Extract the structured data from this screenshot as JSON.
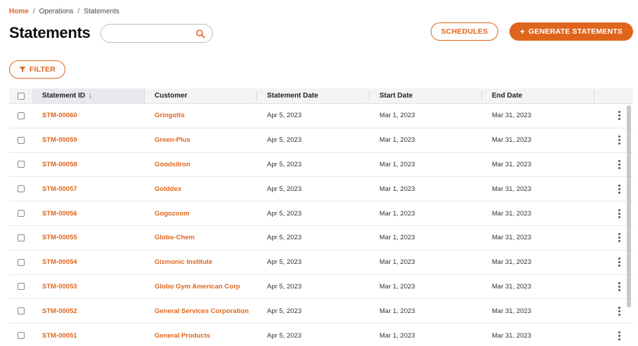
{
  "breadcrumb": {
    "home": "Home",
    "sep1": "/",
    "section": "Operations",
    "sep2": "/",
    "current": "Statements"
  },
  "page_title": "Statements",
  "search": {
    "value": "",
    "placeholder": ""
  },
  "buttons": {
    "schedules": "SCHEDULES",
    "generate_icon": "+",
    "generate": "GENERATE STATEMENTS",
    "filter": "FILTER"
  },
  "columns": {
    "statement_id": "Statement ID",
    "sort_indicator": "↓",
    "customer": "Customer",
    "statement_date": "Statement Date",
    "start_date": "Start Date",
    "end_date": "End Date"
  },
  "rows": [
    {
      "id": "STM-00060",
      "customer": "Gringotts",
      "statement_date": "Apr 5, 2023",
      "start_date": "Mar 1, 2023",
      "end_date": "Mar 31, 2023"
    },
    {
      "id": "STM-00059",
      "customer": "Green-Plus",
      "statement_date": "Apr 5, 2023",
      "start_date": "Mar 1, 2023",
      "end_date": "Mar 31, 2023"
    },
    {
      "id": "STM-00058",
      "customer": "Goodsilron",
      "statement_date": "Apr 5, 2023",
      "start_date": "Mar 1, 2023",
      "end_date": "Mar 31, 2023"
    },
    {
      "id": "STM-00057",
      "customer": "Golddex",
      "statement_date": "Apr 5, 2023",
      "start_date": "Mar 1, 2023",
      "end_date": "Mar 31, 2023"
    },
    {
      "id": "STM-00056",
      "customer": "Gogozoom",
      "statement_date": "Apr 5, 2023",
      "start_date": "Mar 1, 2023",
      "end_date": "Mar 31, 2023"
    },
    {
      "id": "STM-00055",
      "customer": "Globo-Chem",
      "statement_date": "Apr 5, 2023",
      "start_date": "Mar 1, 2023",
      "end_date": "Mar 31, 2023"
    },
    {
      "id": "STM-00054",
      "customer": "Gizmonic Institute",
      "statement_date": "Apr 5, 2023",
      "start_date": "Mar 1, 2023",
      "end_date": "Mar 31, 2023"
    },
    {
      "id": "STM-00053",
      "customer": "Globo Gym American Corp",
      "statement_date": "Apr 5, 2023",
      "start_date": "Mar 1, 2023",
      "end_date": "Mar 31, 2023"
    },
    {
      "id": "STM-00052",
      "customer": "General Services Corporation",
      "statement_date": "Apr 5, 2023",
      "start_date": "Mar 1, 2023",
      "end_date": "Mar 31, 2023"
    },
    {
      "id": "STM-00051",
      "customer": "General Products",
      "statement_date": "Apr 5, 2023",
      "start_date": "Mar 1, 2023",
      "end_date": "Mar 31, 2023"
    }
  ],
  "icons": {
    "search": "search-icon",
    "filter": "filter-icon",
    "sort": "arrow-down-icon",
    "row_menu": "kebab-menu-icon"
  },
  "colors": {
    "accent": "#e0651c",
    "header_bg": "#f4f4f4",
    "sorted_header_bg": "#e8e8ee"
  }
}
